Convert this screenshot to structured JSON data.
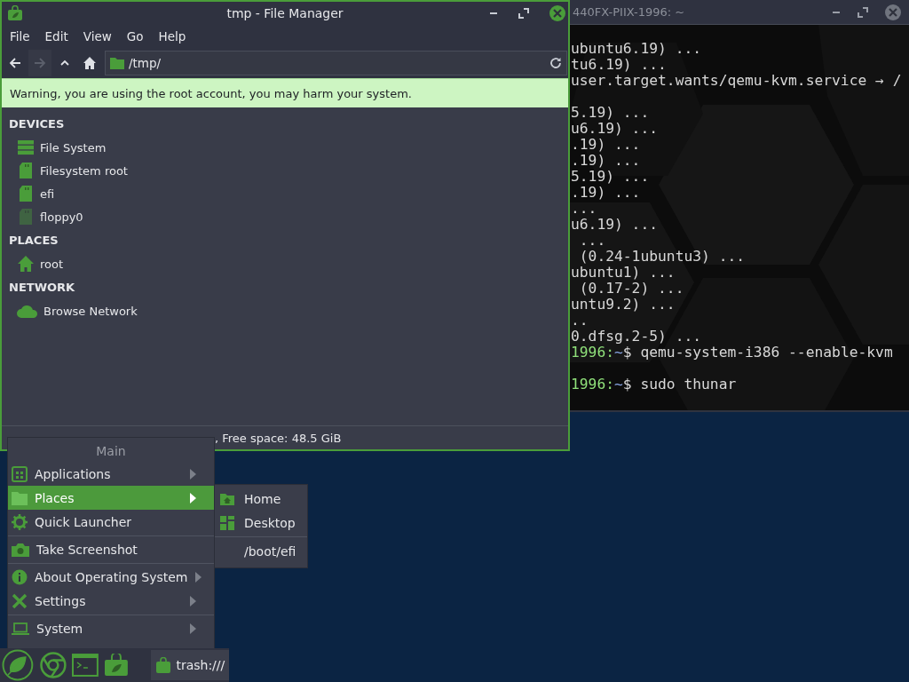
{
  "terminal": {
    "title": "440FX-PIIX-1996: ~",
    "lines": [
      {
        "kind": "output",
        "text": "ubuntu6.19) ..."
      },
      {
        "kind": "output",
        "text": "tu6.19) ..."
      },
      {
        "kind": "output",
        "text": "user.target.wants/qemu-kvm.service → /"
      },
      {
        "kind": "blank"
      },
      {
        "kind": "output",
        "text": "5.19) ..."
      },
      {
        "kind": "output",
        "text": "u6.19) ..."
      },
      {
        "kind": "output",
        "text": ".19) ..."
      },
      {
        "kind": "output",
        "text": ".19) ..."
      },
      {
        "kind": "output",
        "text": "5.19) ..."
      },
      {
        "kind": "output",
        "text": ".19) ..."
      },
      {
        "kind": "output",
        "text": "..."
      },
      {
        "kind": "output",
        "text": "u6.19) ..."
      },
      {
        "kind": "output",
        "text": " ..."
      },
      {
        "kind": "output",
        "text": " (0.24-1ubuntu3) ..."
      },
      {
        "kind": "output",
        "text": "ubuntu1) ..."
      },
      {
        "kind": "output",
        "text": " (0.17-2) ..."
      },
      {
        "kind": "output",
        "text": "untu9.2) ..."
      },
      {
        "kind": "output",
        "text": ".."
      },
      {
        "kind": "output",
        "text": "0.dfsg.2-5) ..."
      },
      {
        "kind": "prompt",
        "host": "1996:",
        "dir": "~",
        "command": "$ qemu-system-i386 --enable-kvm"
      },
      {
        "kind": "blank"
      },
      {
        "kind": "prompt",
        "host": "1996:",
        "dir": "~",
        "command": "$ sudo thunar"
      }
    ]
  },
  "file_manager": {
    "title": "tmp - File Manager",
    "menu": [
      "File",
      "Edit",
      "View",
      "Go",
      "Help"
    ],
    "toolbar": [
      {
        "kind": "back",
        "disabled": false
      },
      {
        "kind": "forward",
        "disabled": true
      },
      {
        "kind": "up",
        "disabled": false
      },
      {
        "kind": "home",
        "disabled": false
      }
    ],
    "location": "/tmp/",
    "warning": "Warning, you are using the root account, you may harm your system.",
    "sidebar": [
      {
        "heading": "DEVICES",
        "items": [
          {
            "label": "File System",
            "kind": "drive",
            "mounted": true
          },
          {
            "label": "Filesystem root",
            "kind": "card",
            "mounted": true
          },
          {
            "label": "efi",
            "kind": "card",
            "mounted": true
          },
          {
            "label": "floppy0",
            "kind": "card",
            "mounted": false
          }
        ]
      },
      {
        "heading": "PLACES",
        "items": [
          {
            "label": "root",
            "kind": "home"
          }
        ]
      },
      {
        "heading": "NETWORK",
        "items": [
          {
            "label": "Browse Network",
            "kind": "network"
          }
        ]
      }
    ],
    "status": ", Free space: 48.5 GiB"
  },
  "menu": {
    "title": "Main",
    "items": [
      {
        "kind": "item",
        "label": "Applications",
        "submenu": true,
        "selected": false
      },
      {
        "kind": "item",
        "label": "Places",
        "submenu": true,
        "selected": true
      },
      {
        "kind": "item",
        "label": "Quick Launcher",
        "submenu": false,
        "selected": false
      },
      {
        "kind": "separator"
      },
      {
        "kind": "item",
        "label": "Take Screenshot",
        "submenu": false,
        "selected": false
      },
      {
        "kind": "separator"
      },
      {
        "kind": "item",
        "label": "About Operating System",
        "submenu": true,
        "selected": false
      },
      {
        "kind": "item",
        "label": "Settings",
        "submenu": true,
        "selected": false
      },
      {
        "kind": "separator"
      },
      {
        "kind": "item",
        "label": "System",
        "submenu": true,
        "selected": false
      }
    ]
  },
  "submenu": {
    "items": [
      {
        "kind": "item",
        "label": "Home"
      },
      {
        "kind": "item",
        "label": "Desktop"
      },
      {
        "kind": "separator"
      },
      {
        "kind": "item",
        "label": "/boot/efi"
      }
    ]
  },
  "taskbar": {
    "task": "trash:///"
  }
}
